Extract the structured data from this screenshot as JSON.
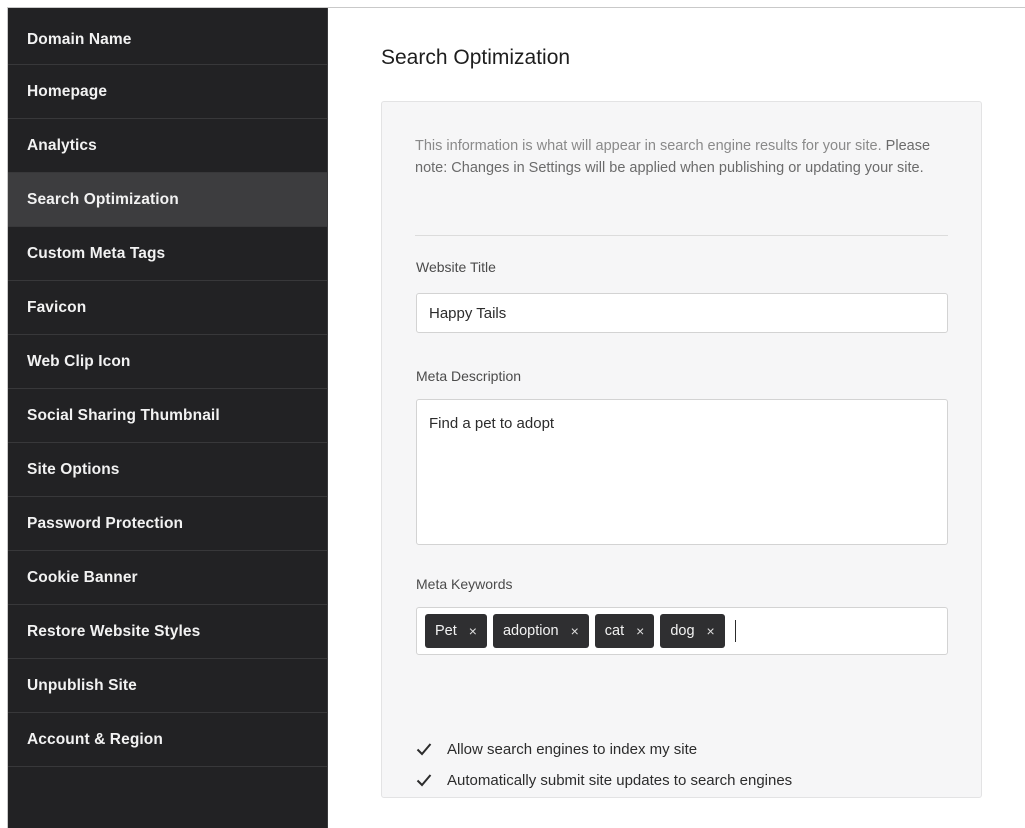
{
  "sidebar": {
    "items": [
      {
        "label": "Domain Name"
      },
      {
        "label": "Homepage"
      },
      {
        "label": "Analytics"
      },
      {
        "label": "Search Optimization"
      },
      {
        "label": "Custom Meta Tags"
      },
      {
        "label": "Favicon"
      },
      {
        "label": "Web Clip Icon"
      },
      {
        "label": "Social Sharing Thumbnail"
      },
      {
        "label": "Site Options"
      },
      {
        "label": "Password Protection"
      },
      {
        "label": "Cookie Banner"
      },
      {
        "label": "Restore Website Styles"
      },
      {
        "label": "Unpublish Site"
      },
      {
        "label": "Account & Region"
      }
    ],
    "active": "Search Optimization"
  },
  "main": {
    "title": "Search Optimization",
    "intro_part1": "This information is what will appear in search engine results for your site.",
    "intro_part2": "Please note: Changes in Settings will be applied when publishing or updating your site.",
    "website_title": {
      "label": "Website Title",
      "value": "Happy Tails"
    },
    "meta_description": {
      "label": "Meta Description",
      "value": "Find a pet to adopt"
    },
    "meta_keywords": {
      "label": "Meta Keywords",
      "tags": [
        {
          "text": "Pet"
        },
        {
          "text": "adoption"
        },
        {
          "text": "cat"
        },
        {
          "text": "dog"
        }
      ],
      "remove_symbol": "×"
    },
    "checkboxes": [
      {
        "label": "Allow search engines to index my site",
        "checked": true
      },
      {
        "label": "Automatically submit site updates to search engines",
        "checked": true
      }
    ]
  },
  "colors": {
    "sidebar_bg": "#222224",
    "sidebar_active": "#3d3d3f",
    "tag_bg": "#2f2f31",
    "card_bg": "#f6f6f7"
  },
  "icons": {
    "check": "check-icon",
    "remove": "close-icon"
  }
}
